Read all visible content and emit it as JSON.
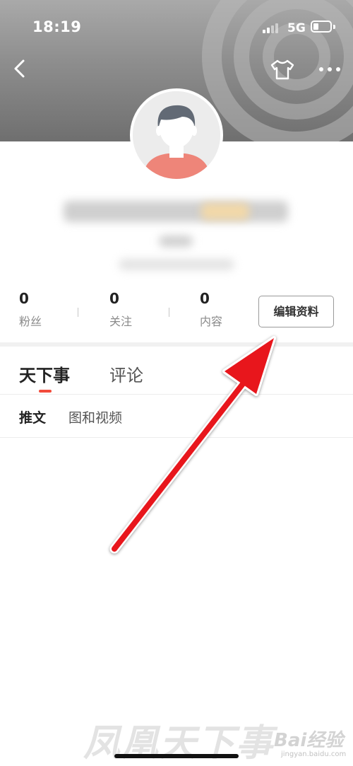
{
  "status_bar": {
    "time": "18:19",
    "network": "5G"
  },
  "icons": {
    "back": "back-chevron-icon",
    "shirt": "skin-shirt-icon",
    "more": "more-dots-icon",
    "avatar": "default-avatar-icon",
    "arrow": "red-arrow-annotation"
  },
  "colors": {
    "accent": "#f24b3b",
    "header_gray": "#8d8d8d",
    "arrow_red": "#e8141b"
  },
  "profile": {
    "stats": [
      {
        "value": "0",
        "label": "粉丝"
      },
      {
        "value": "0",
        "label": "关注"
      },
      {
        "value": "0",
        "label": "内容"
      }
    ],
    "edit_button": "编辑资料"
  },
  "tabs": [
    {
      "label": "天下事",
      "active": true
    },
    {
      "label": "评论",
      "active": false
    }
  ],
  "subtabs": [
    {
      "label": "推文",
      "active": true
    },
    {
      "label": "图和视频",
      "active": false
    }
  ],
  "watermark": {
    "brand": "凤凰天下事",
    "baidu": "Bai经验",
    "baidu_url": "jingyan.baidu.com"
  }
}
